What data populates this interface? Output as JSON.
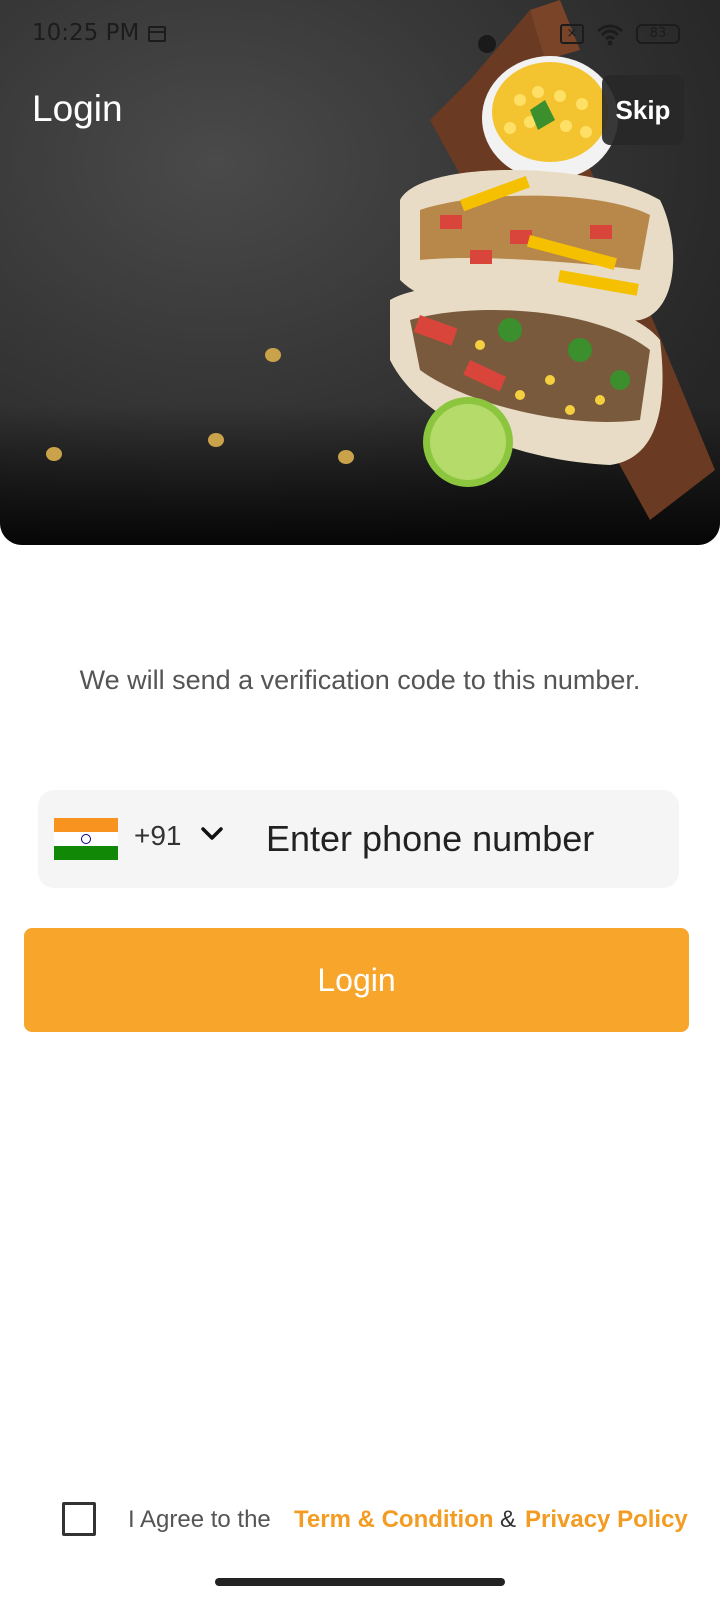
{
  "status_bar": {
    "time": "10:25 PM",
    "battery": "83"
  },
  "header": {
    "title": "Login",
    "skip_label": "Skip"
  },
  "main": {
    "description": "We will send a verification code to this number.",
    "country_code": "+91",
    "phone_placeholder": "Enter phone number",
    "login_label": "Login"
  },
  "footer": {
    "agree_text": "I Agree to the",
    "terms_label": "Term & Condition",
    "amp": "&",
    "privacy_label": "Privacy Policy"
  },
  "colors": {
    "accent": "#f8a52c",
    "link": "#f39c23"
  }
}
